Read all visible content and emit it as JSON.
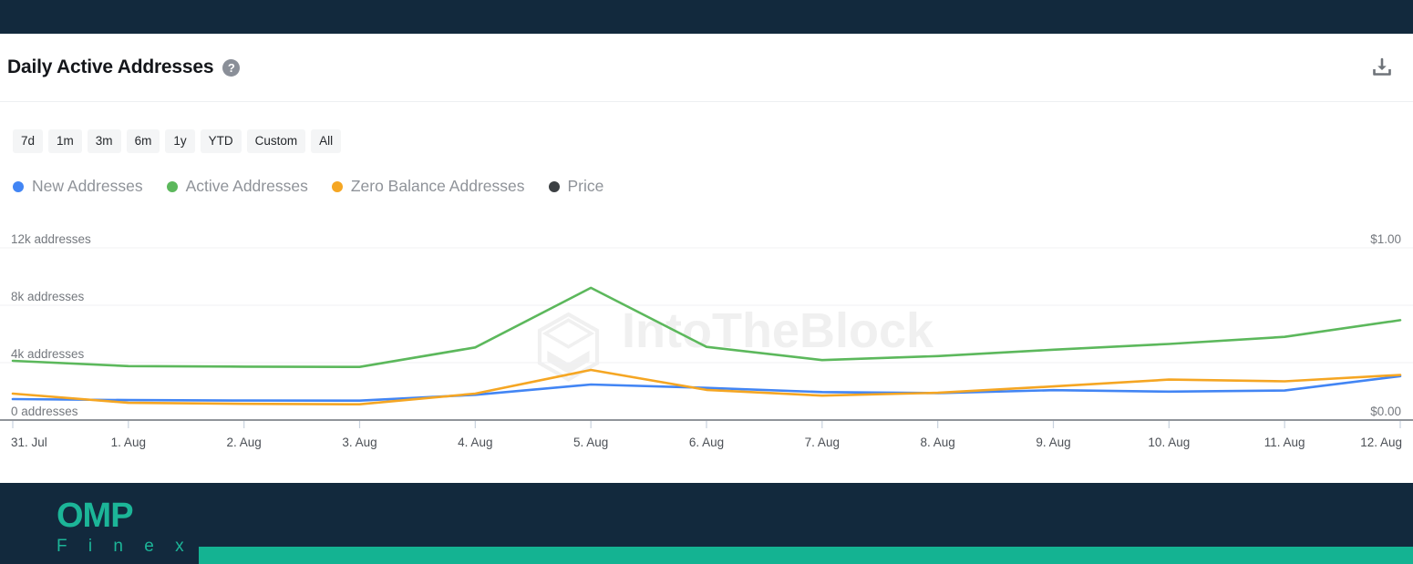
{
  "header": {
    "title": "Daily Active Addresses",
    "help_icon": "question-mark-icon",
    "download_icon": "download-icon"
  },
  "ranges": {
    "options": [
      "7d",
      "1m",
      "3m",
      "6m",
      "1y",
      "YTD",
      "Custom",
      "All"
    ]
  },
  "legend": {
    "items": [
      {
        "label": "New Addresses",
        "color": "#4285f4"
      },
      {
        "label": "Active Addresses",
        "color": "#5cb85c"
      },
      {
        "label": "Zero Balance Addresses",
        "color": "#f5a623"
      },
      {
        "label": "Price",
        "color": "#3c4043"
      }
    ]
  },
  "footer": {
    "logo_primary": "OMP",
    "logo_secondary": "F i n e x",
    "brand_color": "#1cb598",
    "bar_color": "#14b392"
  },
  "chart_data": {
    "type": "line",
    "title": "Daily Active Addresses",
    "watermark": "IntoTheBlock",
    "xlabel": "",
    "ylabel": "addresses",
    "grid": true,
    "legend_position": "top-left",
    "categories": [
      "31. Jul",
      "1. Aug",
      "2. Aug",
      "3. Aug",
      "4. Aug",
      "5. Aug",
      "6. Aug",
      "7. Aug",
      "8. Aug",
      "9. Aug",
      "10. Aug",
      "11. Aug",
      "12. Aug"
    ],
    "y_left_ticks": [
      "0 addresses",
      "4k addresses",
      "8k addresses",
      "12k addresses"
    ],
    "y_left_values": [
      0,
      4000,
      8000,
      12000
    ],
    "ylim": [
      0,
      12000
    ],
    "y_right_ticks": [
      "$0.00",
      "$1.00"
    ],
    "y_right_values": [
      0,
      1
    ],
    "y_right_lim": [
      0,
      1
    ],
    "series": [
      {
        "name": "New Addresses",
        "color": "#4285f4",
        "axis": "left",
        "values": [
          1460,
          1390,
          1360,
          1350,
          1760,
          2475,
          2240,
          1950,
          1880,
          2080,
          1980,
          2060,
          3060
        ]
      },
      {
        "name": "Active Addresses",
        "color": "#5cb85c",
        "axis": "left",
        "values": [
          4130,
          3760,
          3720,
          3700,
          5060,
          9210,
          5100,
          4180,
          4460,
          4900,
          5300,
          5800,
          6960
        ]
      },
      {
        "name": "Zero Balance Addresses",
        "color": "#f5a623",
        "axis": "left",
        "values": [
          1840,
          1200,
          1130,
          1100,
          1840,
          3490,
          2100,
          1700,
          1900,
          2340,
          2820,
          2700,
          3140
        ]
      },
      {
        "name": "Price",
        "color": "#3c4043",
        "axis": "right",
        "values": []
      }
    ]
  }
}
